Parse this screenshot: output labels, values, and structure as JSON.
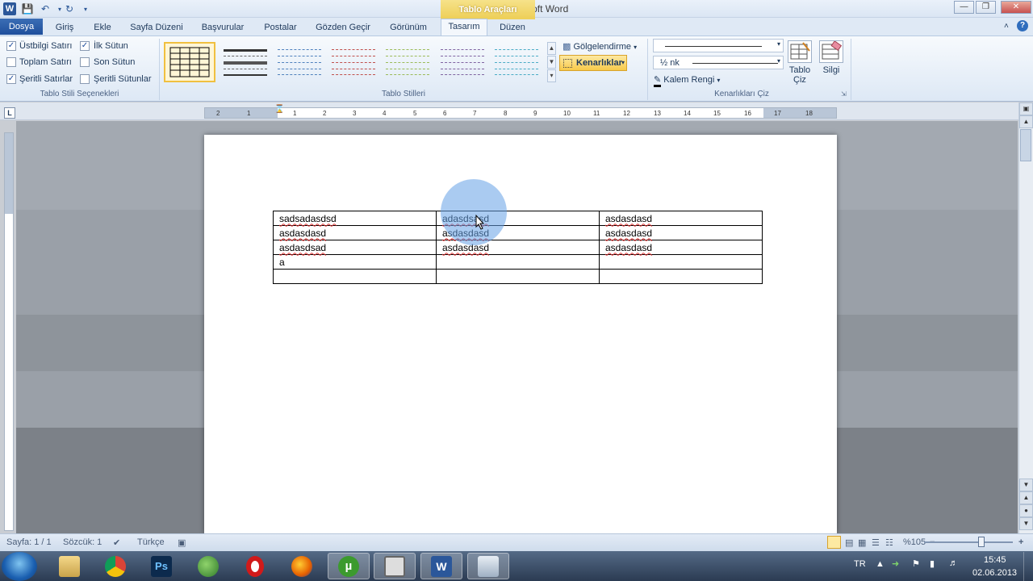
{
  "window": {
    "title": "Belge1 - Microsoft Word",
    "context_tab_group": "Tablo Araçları",
    "app_icon": "W"
  },
  "tabs": [
    "Dosya",
    "Giriş",
    "Ekle",
    "Sayfa Düzeni",
    "Başvurular",
    "Postalar",
    "Gözden Geçir",
    "Görünüm",
    "Tasarım",
    "Düzen"
  ],
  "ribbon": {
    "style_options": {
      "label": "Tablo Stili Seçenekleri",
      "items": [
        {
          "label": "Üstbilgi Satırı",
          "checked": true
        },
        {
          "label": "İlk Sütun",
          "checked": true
        },
        {
          "label": "Toplam Satırı",
          "checked": false
        },
        {
          "label": "Son Sütun",
          "checked": false
        },
        {
          "label": "Şeritli Satırlar",
          "checked": true
        },
        {
          "label": "Şeritli Sütunlar",
          "checked": false
        }
      ]
    },
    "table_styles": {
      "label": "Tablo Stilleri",
      "colors": [
        "#000000",
        "#222222",
        "#4f81bd",
        "#c0504d",
        "#9bbb59",
        "#8064a2",
        "#4bacc6"
      ]
    },
    "shading_label": "Gölgelendirme",
    "borders_label": "Kenarlıklar",
    "borders_draw": {
      "label": "Kenarlıkları Çiz",
      "weight": "½ nk",
      "pen_color_label": "Kalem Rengi",
      "draw_table_label": "Tablo Çiz",
      "eraser_label": "Silgi"
    }
  },
  "ruler_ticks": [
    "2",
    "1",
    "1",
    "2",
    "3",
    "4",
    "5",
    "6",
    "7",
    "8",
    "9",
    "10",
    "11",
    "12",
    "13",
    "14",
    "15",
    "16",
    "17",
    "18"
  ],
  "document": {
    "table": [
      [
        "sadsadasdsd",
        "adasdsasd",
        "asdasdasd"
      ],
      [
        "asdasdasd",
        "asdasdasd",
        "asdasdasd"
      ],
      [
        "asdasdsad",
        "asdasdasd",
        "asdasdasd"
      ],
      [
        "a",
        "",
        ""
      ],
      [
        "",
        "",
        ""
      ]
    ]
  },
  "status": {
    "page": "Sayfa: 1 / 1",
    "words": "Sözcük: 1",
    "language": "Türkçe",
    "zoom": "%105"
  },
  "taskbar": {
    "language": "TR",
    "time": "15:45",
    "date": "02.06.2013"
  }
}
